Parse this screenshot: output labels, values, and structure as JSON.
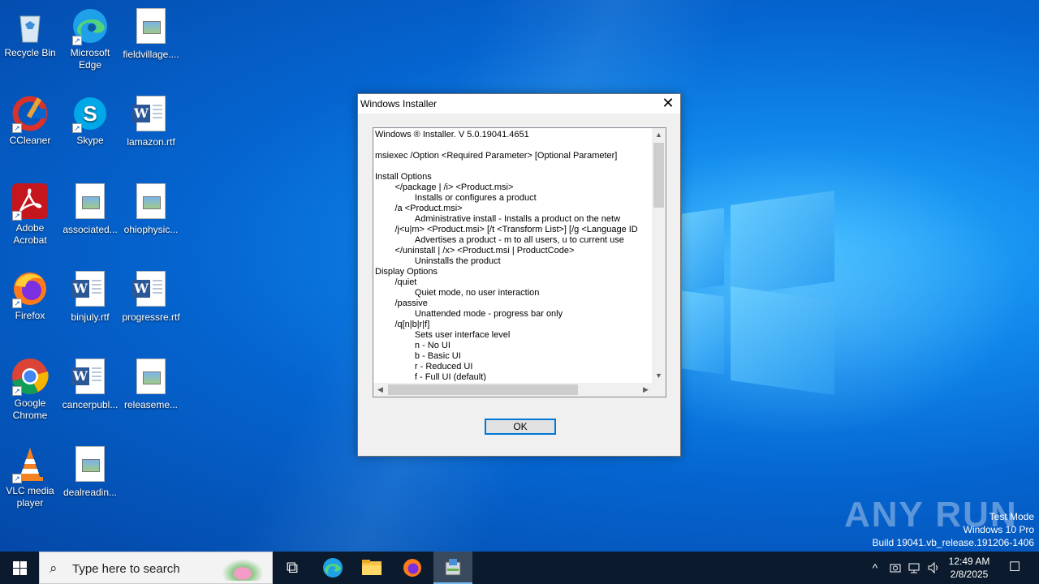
{
  "desktop": {
    "icons": [
      {
        "label": "Recycle Bin"
      },
      {
        "label": "Microsoft Edge"
      },
      {
        "label": "fieldvillage...."
      },
      {
        "label": "CCleaner"
      },
      {
        "label": "Skype"
      },
      {
        "label": "lamazon.rtf"
      },
      {
        "label": "Adobe Acrobat"
      },
      {
        "label": "associated..."
      },
      {
        "label": "ohiophysic..."
      },
      {
        "label": "Firefox"
      },
      {
        "label": "binjuly.rtf"
      },
      {
        "label": "progressre.rtf"
      },
      {
        "label": "Google Chrome"
      },
      {
        "label": "cancerpubl..."
      },
      {
        "label": "releaseme..."
      },
      {
        "label": "VLC media player"
      },
      {
        "label": "dealreadin..."
      }
    ]
  },
  "dialog": {
    "title": "Windows Installer",
    "close_glyph": "✕",
    "text": "Windows ® Installer. V 5.0.19041.4651\n\nmsiexec /Option <Required Parameter> [Optional Parameter]\n\nInstall Options\n\t</package | /i> <Product.msi>\n\t\tInstalls or configures a product\n\t/a <Product.msi>\n\t\tAdministrative install - Installs a product on the netw\n\t/j<u|m> <Product.msi> [/t <Transform List>] [/g <Language ID\n\t\tAdvertises a product - m to all users, u to current use\n\t</uninstall | /x> <Product.msi | ProductCode>\n\t\tUninstalls the product\nDisplay Options\n\t/quiet\n\t\tQuiet mode, no user interaction\n\t/passive\n\t\tUnattended mode - progress bar only\n\t/q[n|b|r|f]\n\t\tSets user interface level\n\t\tn - No UI\n\t\tb - Basic UI\n\t\tr - Reduced UI\n\t\tf - Full UI (default)",
    "ok_label": "OK",
    "scroll_up": "▲",
    "scroll_down": "▼",
    "scroll_left": "◀",
    "scroll_right": "▶"
  },
  "watermark": {
    "brand": "ANY RUN",
    "line1": "Test Mode",
    "line2": "Windows 10 Pro",
    "line3": "Build 19041.vb_release.191206-1406"
  },
  "taskbar": {
    "search_placeholder": "Type here to search",
    "search_icon": "⌕",
    "taskview_icon": "⧉",
    "tray_chevron": "^",
    "clock_time": "12:49 AM",
    "clock_date": "2/8/2025",
    "notif_icon": "☐"
  },
  "colors": {
    "accent": "#0078d7",
    "taskbar": "#0b1a2c",
    "desktop": "#0564cf"
  }
}
